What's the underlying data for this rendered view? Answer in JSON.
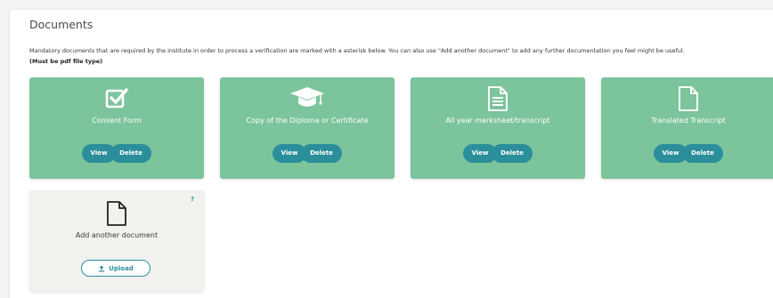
{
  "section": {
    "title": "Documents",
    "description": "Mandatory documents that are required by the institute in order to process a verification are marked with a asterisk below. You can also use \"Add another document\" to add any further documentation you feel might be useful.",
    "note": "(Must be pdf file type)"
  },
  "colors": {
    "card_bg": "#7cc49c",
    "button_bg": "#2b8e9b",
    "upload_card_bg": "#f1f1ee"
  },
  "cards": [
    {
      "label": "Consent Form",
      "icon": "check-square-icon",
      "view_label": "View",
      "delete_label": "Delete"
    },
    {
      "label": "Copy of the Diploma or Certificate",
      "icon": "graduation-cap-icon",
      "view_label": "View",
      "delete_label": "Delete"
    },
    {
      "label": "All year marksheet/transcript",
      "icon": "file-text-icon",
      "view_label": "View",
      "delete_label": "Delete"
    },
    {
      "label": "Translated Transcript",
      "icon": "file-icon",
      "view_label": "View",
      "delete_label": "Delete"
    }
  ],
  "add_card": {
    "label": "Add another document",
    "icon": "file-icon",
    "help": "?",
    "upload_label": "Upload",
    "upload_icon": "upload-icon"
  }
}
